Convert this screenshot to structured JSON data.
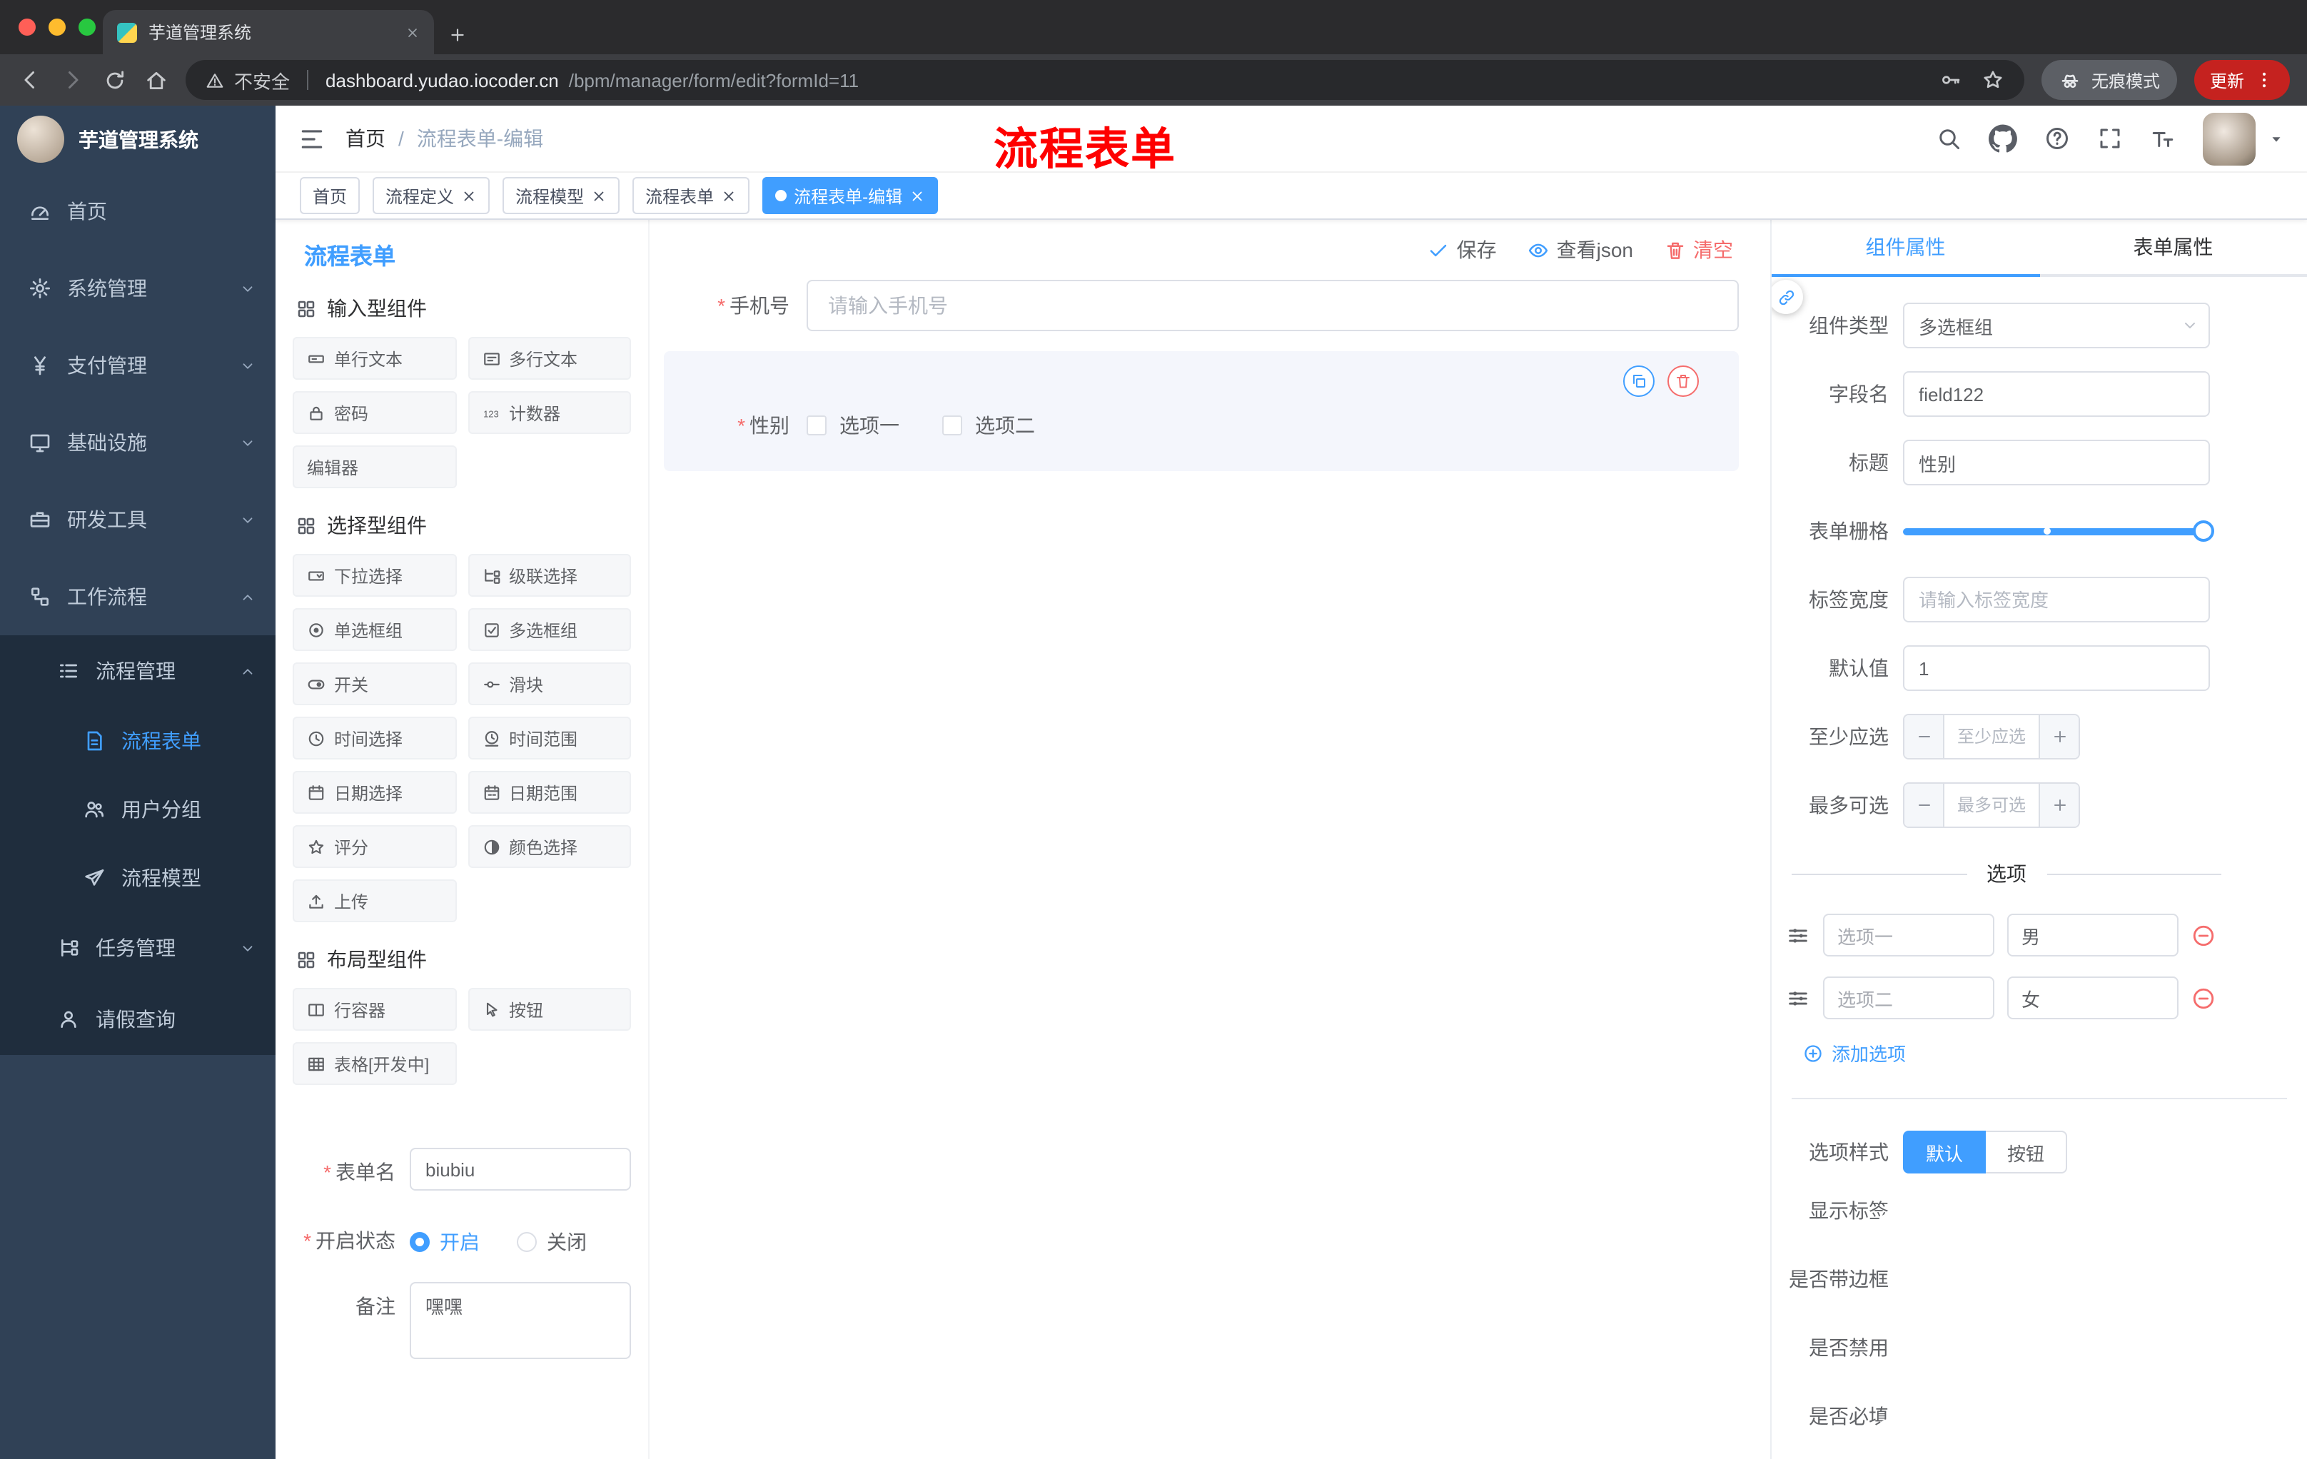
{
  "theme": {
    "primary": "#409eff",
    "danger": "#f56c6c",
    "sidebar_bg": "#304156",
    "submenu_bg": "#1f2d3d",
    "annotation_color": "#fe0000",
    "update_pill_bg": "#c5221f"
  },
  "marks": {
    "required": "*"
  },
  "browser": {
    "tab_title": "芋道管理系统",
    "security_label": "不安全",
    "url_domain": "dashboard.yudao.iocoder.cn",
    "url_path": "/bpm/manager/form/edit?formId=11",
    "incognito_label": "无痕模式",
    "update_label": "更新"
  },
  "sidebar": {
    "logo_title": "芋道管理系统",
    "items": [
      {
        "label": "首页"
      },
      {
        "label": "系统管理"
      },
      {
        "label": "支付管理"
      },
      {
        "label": "基础设施"
      },
      {
        "label": "研发工具"
      },
      {
        "label": "工作流程"
      },
      {
        "label": "流程管理"
      },
      {
        "label": "流程表单"
      },
      {
        "label": "用户分组"
      },
      {
        "label": "流程模型"
      },
      {
        "label": "任务管理"
      },
      {
        "label": "请假查询"
      }
    ]
  },
  "header": {
    "breadcrumb_home": "首页",
    "breadcrumb_sep": "/",
    "breadcrumb_current": "流程表单-编辑",
    "annotation": "流程表单"
  },
  "tags": {
    "items": [
      {
        "label": "首页"
      },
      {
        "label": "流程定义"
      },
      {
        "label": "流程模型"
      },
      {
        "label": "流程表单"
      },
      {
        "label": "流程表单-编辑"
      }
    ]
  },
  "palette": {
    "title": "流程表单",
    "sections": [
      {
        "title": "输入型组件",
        "items": [
          "单行文本",
          "多行文本",
          "密码",
          "计数器",
          "编辑器"
        ]
      },
      {
        "title": "选择型组件",
        "items": [
          "下拉选择",
          "级联选择",
          "单选框组",
          "多选框组",
          "开关",
          "滑块",
          "时间选择",
          "时间范围",
          "日期选择",
          "日期范围",
          "评分",
          "颜色选择",
          "上传"
        ]
      },
      {
        "title": "布局型组件",
        "items": [
          "行容器",
          "按钮",
          "表格[开发中]"
        ]
      }
    ],
    "meta": {
      "form_name_label": "表单名",
      "form_name_value": "biubiu",
      "status_label": "开启状态",
      "status_on": "开启",
      "status_off": "关闭",
      "remark_label": "备注",
      "remark_value": "嘿嘿"
    }
  },
  "canvas": {
    "toolbar": {
      "save": "保存",
      "view_json": "查看json",
      "clear": "清空"
    },
    "phone_label": "手机号",
    "phone_placeholder": "请输入手机号",
    "gender_label": "性别",
    "gender_options": [
      "选项一",
      "选项二"
    ]
  },
  "props": {
    "tab_component": "组件属性",
    "tab_form": "表单属性",
    "component_type_label": "组件类型",
    "component_type_value": "多选框组",
    "field_name_label": "字段名",
    "field_name_value": "field122",
    "title_label": "标题",
    "title_value": "性别",
    "grid_label": "表单栅格",
    "label_width_label": "标签宽度",
    "label_width_placeholder": "请输入标签宽度",
    "default_label": "默认值",
    "default_value": "1",
    "min_label": "至少应选",
    "min_placeholder": "至少应选",
    "max_label": "最多可选",
    "max_placeholder": "最多可选",
    "options_divider": "选项",
    "options": [
      {
        "label": "选项一",
        "value": "男"
      },
      {
        "label": "选项二",
        "value": "女"
      }
    ],
    "add_option": "添加选项",
    "style_label": "选项样式",
    "style_default": "默认",
    "style_button": "按钮",
    "toggles": [
      {
        "label": "显示标签",
        "on": true
      },
      {
        "label": "是否带边框",
        "on": false
      },
      {
        "label": "是否禁用",
        "on": false
      },
      {
        "label": "是否必填",
        "on": true
      }
    ]
  }
}
